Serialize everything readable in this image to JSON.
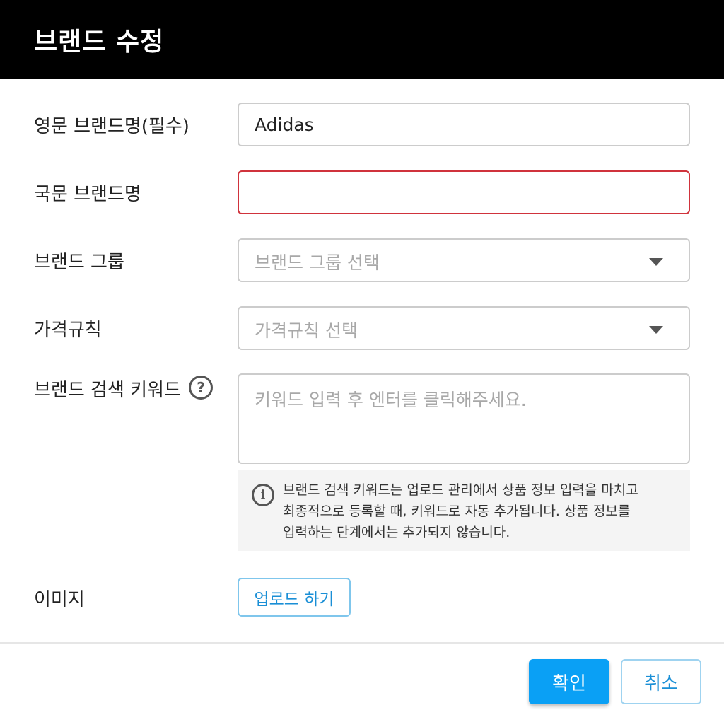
{
  "dialog": {
    "title": "브랜드 수정"
  },
  "form": {
    "english_name": {
      "label": "영문 브랜드명(필수)",
      "value": "Adidas"
    },
    "korean_name": {
      "label": "국문 브랜드명",
      "value": "",
      "state": "error"
    },
    "brand_group": {
      "label": "브랜드 그룹",
      "placeholder": "브랜드 그룹 선택"
    },
    "price_rule": {
      "label": "가격규칙",
      "placeholder": "가격규칙 선택"
    },
    "search_keywords": {
      "label": "브랜드 검색 키워드",
      "help_icon": "question-circle-icon",
      "placeholder": "키워드 입력 후 엔터를 클릭해주세요.",
      "info_icon": "info-circle-icon",
      "info_text": "브랜드 검색 키워드는 업로드 관리에서 상품 정보 입력을 마치고 최종적으로 등록할 때, 키워드로 자동 추가됩니다. 상품 정보를 입력하는 단계에서는 추가되지 않습니다."
    },
    "image": {
      "label": "이미지",
      "upload_label": "업로드 하기"
    }
  },
  "footer": {
    "confirm_label": "확인",
    "cancel_label": "취소"
  },
  "colors": {
    "header_bg": "#000000",
    "primary": "#0aa0f5",
    "error_border": "#d0333c",
    "link_text": "#1a8fd6"
  }
}
